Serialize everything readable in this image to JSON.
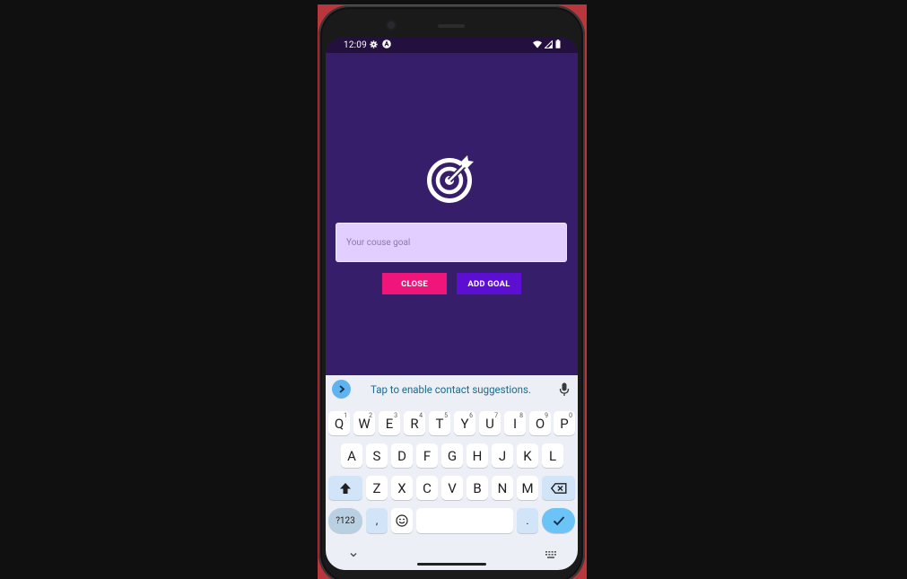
{
  "status_bar": {
    "time": "12:09",
    "left_icons": [
      "gear-icon",
      "app-notification-icon"
    ],
    "right_icons": [
      "wifi-icon",
      "signal-icon",
      "battery-icon"
    ]
  },
  "app": {
    "logo_icon": "target-icon",
    "goal_input": {
      "value": "",
      "placeholder": "Your couse goal"
    },
    "close_button_label": "CLOSE",
    "add_goal_button_label": "ADD GOAL",
    "colors": {
      "background": "#371e6b",
      "input_background": "#e2ceff",
      "close_button": "#f0157a",
      "add_goal_button": "#5c0fd3"
    }
  },
  "keyboard": {
    "suggestion_text": "Tap to enable contact suggestions.",
    "row1": [
      {
        "key": "Q",
        "hint": "1"
      },
      {
        "key": "W",
        "hint": "2"
      },
      {
        "key": "E",
        "hint": "3"
      },
      {
        "key": "R",
        "hint": "4"
      },
      {
        "key": "T",
        "hint": "5"
      },
      {
        "key": "Y",
        "hint": "6"
      },
      {
        "key": "U",
        "hint": "7"
      },
      {
        "key": "I",
        "hint": "8"
      },
      {
        "key": "O",
        "hint": "9"
      },
      {
        "key": "P",
        "hint": "0"
      }
    ],
    "row2": [
      "A",
      "S",
      "D",
      "F",
      "G",
      "H",
      "J",
      "K",
      "L"
    ],
    "row3": [
      "Z",
      "X",
      "C",
      "V",
      "B",
      "N",
      "M"
    ],
    "symbols_key": "?123",
    "comma_key": ",",
    "period_key": "."
  }
}
